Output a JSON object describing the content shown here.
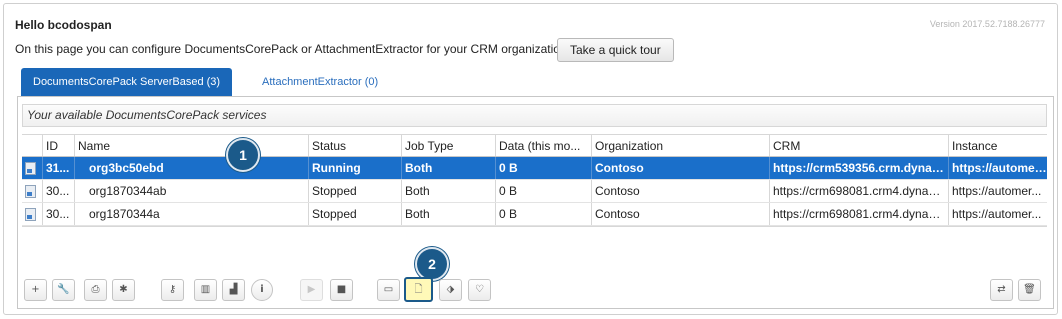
{
  "header": {
    "greeting": "Hello bcodospan",
    "version": "Version 2017.52.7188.26777",
    "intro": "On this page you can configure DocumentsCorePack or AttachmentExtractor for your CRM organization.",
    "tour_label": "Take a quick tour"
  },
  "tabs": [
    {
      "label": "DocumentsCorePack ServerBased (3)",
      "active": true
    },
    {
      "label": "AttachmentExtractor (0)",
      "active": false
    }
  ],
  "grid": {
    "title": "Your available DocumentsCorePack services",
    "columns": [
      "ID",
      "Name",
      "Status",
      "Job Type",
      "Data (this mo...",
      "Organization",
      "CRM",
      "Instance"
    ],
    "rows": [
      {
        "id": "31...",
        "name": "org3bc50ebd",
        "status": "Running",
        "job": "Both",
        "data": "0 B",
        "org": "Contoso",
        "crm": "https://crm539356.crm.dynamic...",
        "instance": "https://automer...",
        "selected": true
      },
      {
        "id": "30...",
        "name": "org1870344ab",
        "status": "Stopped",
        "job": "Both",
        "data": "0 B",
        "org": "Contoso",
        "crm": "https://crm698081.crm4.dynam...",
        "instance": "https://automer...",
        "selected": false
      },
      {
        "id": "30...",
        "name": "org1870344a",
        "status": "Stopped",
        "job": "Both",
        "data": "0 B",
        "org": "Contoso",
        "crm": "https://crm698081.crm4.dynam...",
        "instance": "https://automer...",
        "selected": false
      }
    ]
  },
  "badges": [
    "1",
    "2"
  ],
  "toolbar": {
    "add": "+",
    "wrench": "🔧",
    "print": "⎙",
    "gear": "✱",
    "key": "⚷",
    "list": "▥",
    "chart": "▟",
    "info": "i",
    "play": "▶",
    "stop": "■",
    "save": "▭",
    "doc": "🗋",
    "tag": "⬗",
    "bulb": "♡",
    "swap": "⇄",
    "delete": "🗑"
  },
  "colors": {
    "accent": "#1a67b8",
    "selected_row": "#1a6fca",
    "badge": "#1b5a8a",
    "highlight": "#fff9b8"
  }
}
